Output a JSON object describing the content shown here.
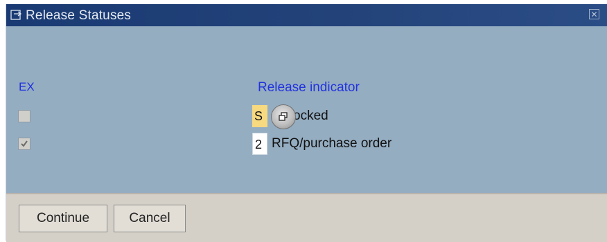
{
  "window": {
    "title": "Release Statuses",
    "close_symbol": "✕"
  },
  "columns": {
    "ex": "EX",
    "release_indicator": "Release indicator"
  },
  "rows": [
    {
      "ex_checked": false,
      "code": "S",
      "description": "ocked"
    },
    {
      "ex_checked": true,
      "code": "2",
      "description": "RFQ/purchase order"
    }
  ],
  "buttons": {
    "continue": "Continue",
    "cancel": "Cancel"
  },
  "icons": {
    "title": "window-icon",
    "help": "possible-entries-icon"
  },
  "colors": {
    "header_text": "#2233dd",
    "title_bar": "#1a3a73",
    "body_bg": "#95adc1",
    "highlight": "#f7d980"
  }
}
